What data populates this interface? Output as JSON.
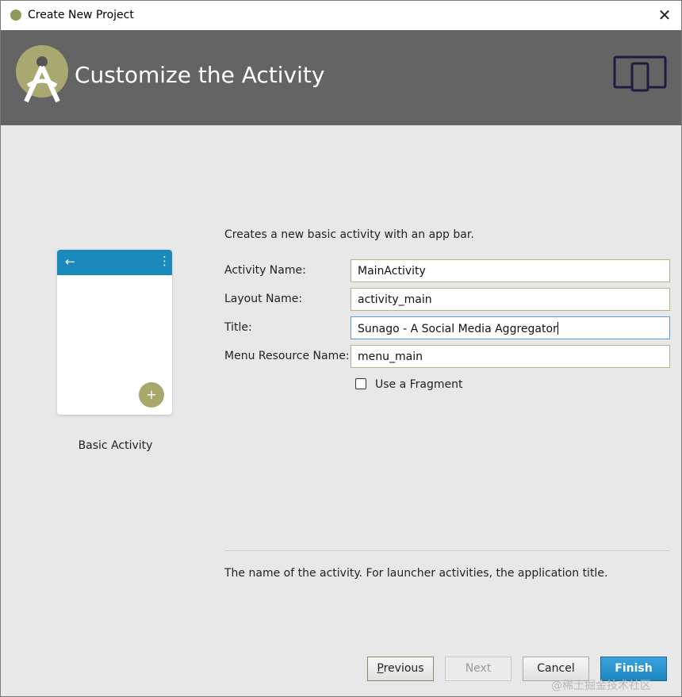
{
  "window": {
    "title": "Create New Project",
    "close_glyph": "✕"
  },
  "banner": {
    "heading": "Customize the Activity",
    "logo_icon": "android-studio-icon",
    "device_icon": "phone-tablet-icon"
  },
  "preview": {
    "template_name": "Basic Activity",
    "back_glyph": "←",
    "more_glyph": "⋮",
    "fab_glyph": "+"
  },
  "form": {
    "description": "Creates a new basic activity with an app bar.",
    "activity_name": {
      "label": "Activity Name:",
      "value": "MainActivity"
    },
    "layout_name": {
      "label": "Layout Name:",
      "value": "activity_main"
    },
    "title": {
      "label": "Title:",
      "value": "Sunago - A Social Media Aggregator"
    },
    "menu_resource": {
      "label": "Menu Resource Name:",
      "value": "menu_main"
    },
    "use_fragment": {
      "label": "Use a Fragment",
      "checked": false
    }
  },
  "help_text": "The name of the activity. For launcher activities, the application title.",
  "buttons": {
    "previous_mnemonic": "P",
    "previous_rest": "revious",
    "next": "Next",
    "cancel": "Cancel",
    "finish": "Finish"
  },
  "watermark": "@稀土掘金技术社区",
  "colors": {
    "banner_bg": "#646464",
    "appbar_blue": "#1a89bc",
    "fab": "#a8a86c",
    "finish_button": "#1c84c0"
  }
}
